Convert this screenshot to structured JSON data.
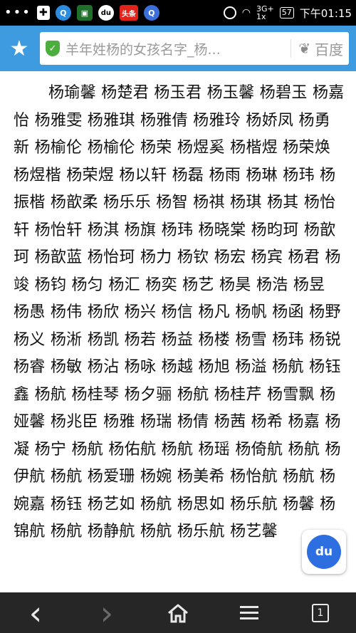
{
  "status_bar": {
    "dots": "•••",
    "icons": [
      "shield-icon",
      "q-app-icon",
      "bag-icon",
      "baidu-du-icon",
      "toutiao-icon",
      "q-app2-icon"
    ],
    "toutiao_label": "头条",
    "du_label": "du",
    "signal_label": "3G+\n1x",
    "battery": "57",
    "time": "下午01:15"
  },
  "address_bar": {
    "url_text": "羊年姓杨的女孩名字_杨...",
    "engine_label": "百度"
  },
  "content": {
    "names_text": "杨瑜馨 杨楚君 杨玉君 杨玉馨 杨碧玉 杨嘉怡 杨雅雯 杨雅琪 杨雅倩 杨雅玲 杨娇凤 杨勇新 杨榆伦 杨榆伦 杨荣 杨煜奚 杨楷煜 杨荣焕 杨煜楷 杨荣煜 杨以轩 杨磊 杨雨 杨琳 杨玮 杨振楷 杨歆柔 杨乐乐 杨智 杨祺 杨琪 杨其 杨怡轩 杨怡轩 杨淇 杨旗 杨玮 杨晓棠 杨昀珂 杨歆珂 杨歆蓝 杨怡珂 杨力 杨钦 杨宏 杨宾 杨君 杨竣 杨钧 杨匀 杨汇 杨奕 杨艺 杨昊 杨浩 杨昱 杨愚 杨伟 杨欣 杨兴 杨信 杨凡 杨帆 杨函 杨野 杨义 杨淅 杨凯 杨若 杨益 杨楼 杨雪 杨玮 杨锐 杨睿 杨敏 杨沾 杨咏 杨越 杨旭 杨溢 杨航 杨钰鑫 杨航 杨桂琴 杨夕骊 杨航 杨桂芹 杨雪飘 杨娅馨 杨兆臣 杨雅 杨瑞 杨倩 杨茜 杨希 杨嘉 杨凝 杨宁 杨航 杨佑航 杨航 杨瑶 杨倚航 杨航 杨伊航 杨航 杨爱珊 杨婉 杨美希 杨怡航 杨航 杨婉嘉 杨钰 杨艺如 杨航 杨思如 杨乐航 杨馨 杨锦航 杨航 杨静航 杨航 杨乐航 杨艺馨"
  },
  "floating_button": {
    "label": "du"
  },
  "bottom_nav": {
    "back": "‹",
    "forward": "›",
    "tabs_count": "1"
  }
}
